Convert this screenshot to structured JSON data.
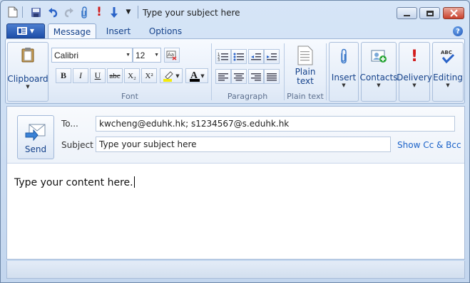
{
  "window": {
    "title": "Type your subject here"
  },
  "tabs": [
    {
      "label": "Message",
      "active": true
    },
    {
      "label": "Insert",
      "active": false
    },
    {
      "label": "Options",
      "active": false
    }
  ],
  "ribbon": {
    "clipboard": {
      "label": "Clipboard"
    },
    "font": {
      "family": "Calibri",
      "size": "12",
      "bold": "B",
      "italic": "I",
      "underline": "U",
      "strike": "abc",
      "subscript": "X₂",
      "superscript": "X²",
      "group_label": "Font"
    },
    "paragraph": {
      "group_label": "Paragraph"
    },
    "plain_text": {
      "button_label_line1": "Plain",
      "button_label_line2": "text",
      "group_label": "Plain text"
    },
    "insert": {
      "label": "Insert"
    },
    "contacts": {
      "label": "Contacts"
    },
    "delivery": {
      "label": "Delivery"
    },
    "editing": {
      "label": "Editing"
    }
  },
  "compose": {
    "send_label": "Send",
    "to_label": "To...",
    "to_value": "kwcheng@eduhk.hk; s1234567@s.eduhk.hk",
    "subject_label": "Subject",
    "subject_value": "Type your subject here",
    "show_cc_bcc": "Show Cc & Bcc",
    "body": "Type your content here."
  },
  "colors": {
    "accent": "#15428b",
    "link": "#1a62c8",
    "close_button": "#c9412c"
  }
}
